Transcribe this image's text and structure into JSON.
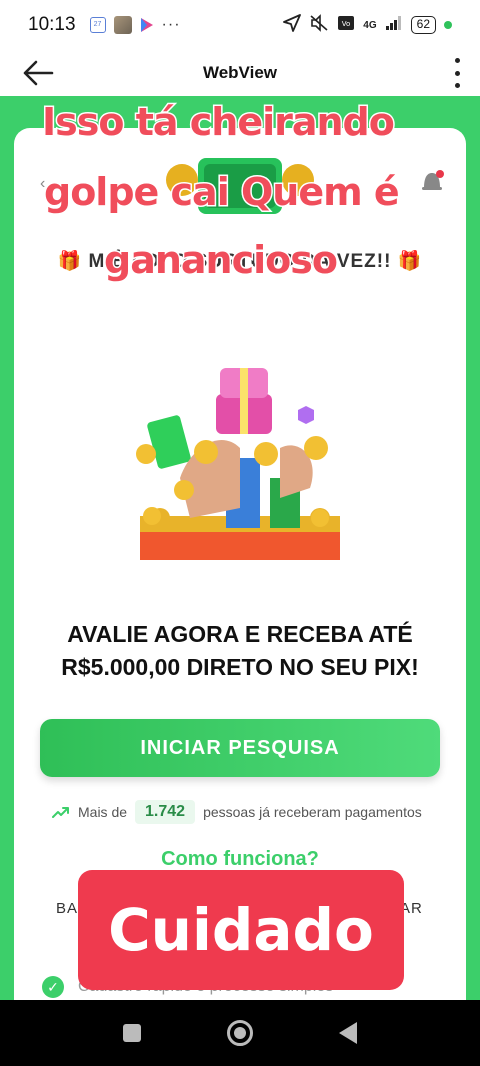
{
  "status_bar": {
    "time": "10:13",
    "calendar_badge": "27",
    "more_dots": "···",
    "network": "4G",
    "battery": "62",
    "dot_color": "#2fc25b"
  },
  "app_bar": {
    "title": "WebView"
  },
  "page": {
    "headline_fragment": "🎁 M              Ê FOI O SURTUDO DA VEZ!! 🎁",
    "cta_title": "AVALIE AGORA E RECEBA ATÉ R$5.000,00 DIRETO NO SEU PIX!",
    "start_button": "INICIAR PESQUISA",
    "stats_prefix": "Mais de",
    "stats_count": "1.742",
    "stats_suffix": "pessoas já receberam pagamentos",
    "how_title": "Como funciona?",
    "how_fragment_left": "BA",
    "how_fragment_right": "AR",
    "check_item": "Cadastro rápido e processo simples"
  },
  "overlay": {
    "line1": "Isso tá cheirando",
    "line2": "golpe cai Quem é",
    "line3": "ganancioso",
    "warning": "Cuidado"
  },
  "colors": {
    "brand_green": "#3ccf6a",
    "overlay_red": "#f04d5b",
    "warning_red": "#ef3a4e"
  },
  "icons": {
    "back": "arrow-left-icon",
    "menu": "more-vertical-icon",
    "trend": "trending-up-icon",
    "check": "check-circle-icon"
  }
}
